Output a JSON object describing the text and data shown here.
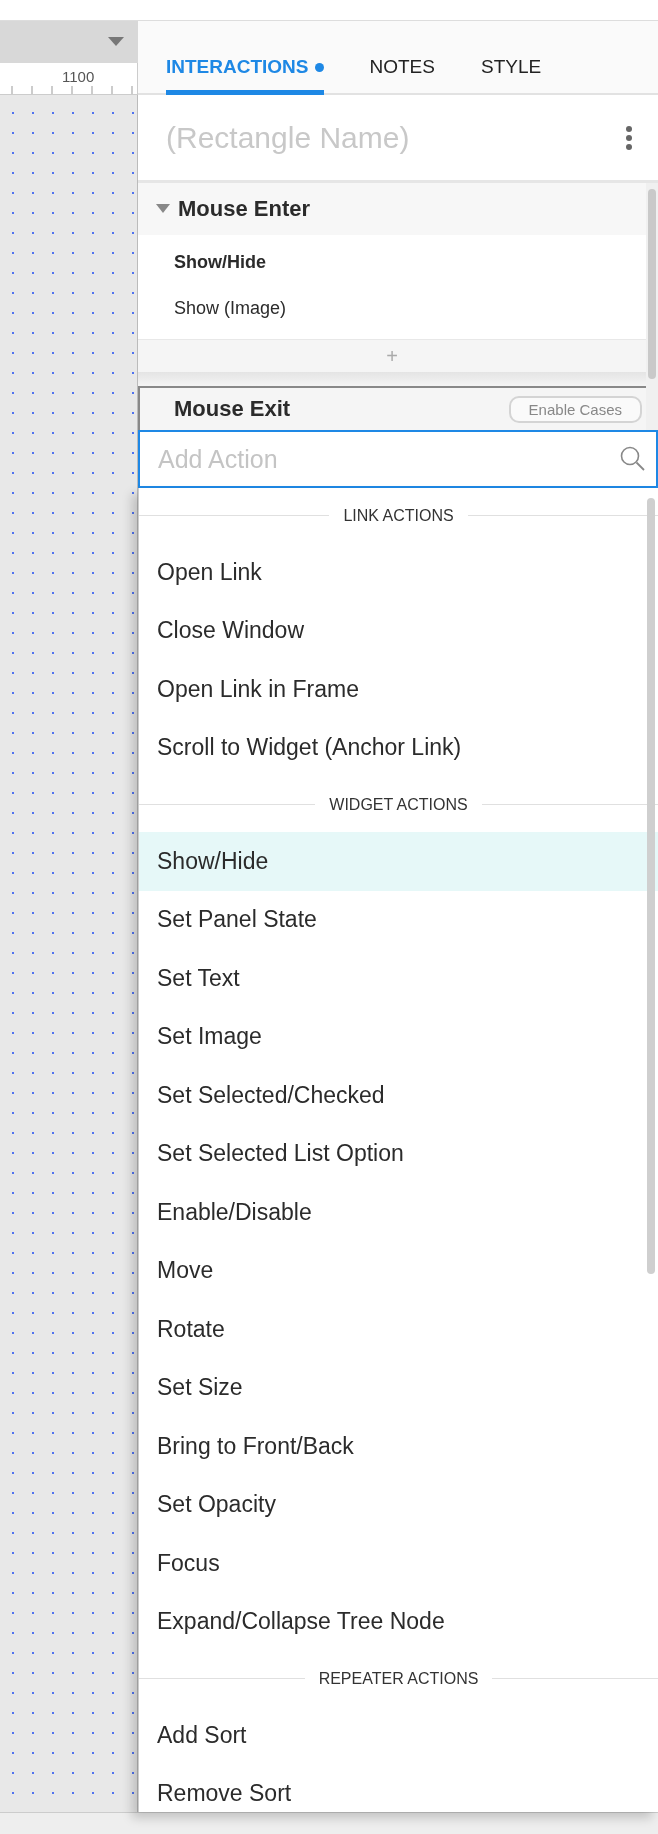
{
  "canvas": {
    "ruler_label": "1100"
  },
  "tabs": [
    {
      "label": "INTERACTIONS",
      "selected": true,
      "dot": true
    },
    {
      "label": "NOTES",
      "selected": false,
      "dot": false
    },
    {
      "label": "STYLE",
      "selected": false,
      "dot": false
    }
  ],
  "widget_name": {
    "placeholder": "(Rectangle Name)"
  },
  "event": {
    "name": "Mouse Enter",
    "expanded": true,
    "rows": [
      {
        "kind": "case",
        "label": "Show/Hide"
      },
      {
        "kind": "action",
        "label": "Show (Image)"
      }
    ],
    "add_label": "+"
  },
  "next_event": {
    "name": "Mouse Exit",
    "button": "Enable Cases"
  },
  "search": {
    "placeholder": "Add Action"
  },
  "action_menu": [
    {
      "kind": "header",
      "label": "LINK ACTIONS"
    },
    {
      "kind": "item",
      "label": "Open Link",
      "selected": false
    },
    {
      "kind": "item",
      "label": "Close Window",
      "selected": false
    },
    {
      "kind": "item",
      "label": "Open Link in Frame",
      "selected": false
    },
    {
      "kind": "item",
      "label": "Scroll to Widget (Anchor Link)",
      "selected": false
    },
    {
      "kind": "header",
      "label": "WIDGET ACTIONS"
    },
    {
      "kind": "item",
      "label": "Show/Hide",
      "selected": true
    },
    {
      "kind": "item",
      "label": "Set Panel State",
      "selected": false
    },
    {
      "kind": "item",
      "label": "Set Text",
      "selected": false
    },
    {
      "kind": "item",
      "label": "Set Image",
      "selected": false
    },
    {
      "kind": "item",
      "label": "Set Selected/Checked",
      "selected": false
    },
    {
      "kind": "item",
      "label": "Set Selected List Option",
      "selected": false
    },
    {
      "kind": "item",
      "label": "Enable/Disable",
      "selected": false
    },
    {
      "kind": "item",
      "label": "Move",
      "selected": false
    },
    {
      "kind": "item",
      "label": "Rotate",
      "selected": false
    },
    {
      "kind": "item",
      "label": "Set Size",
      "selected": false
    },
    {
      "kind": "item",
      "label": "Bring to Front/Back",
      "selected": false
    },
    {
      "kind": "item",
      "label": "Set Opacity",
      "selected": false
    },
    {
      "kind": "item",
      "label": "Focus",
      "selected": false
    },
    {
      "kind": "item",
      "label": "Expand/Collapse Tree Node",
      "selected": false
    },
    {
      "kind": "header",
      "label": "REPEATER ACTIONS"
    },
    {
      "kind": "item",
      "label": "Add Sort",
      "selected": false
    },
    {
      "kind": "item",
      "label": "Remove Sort",
      "selected": false
    }
  ]
}
